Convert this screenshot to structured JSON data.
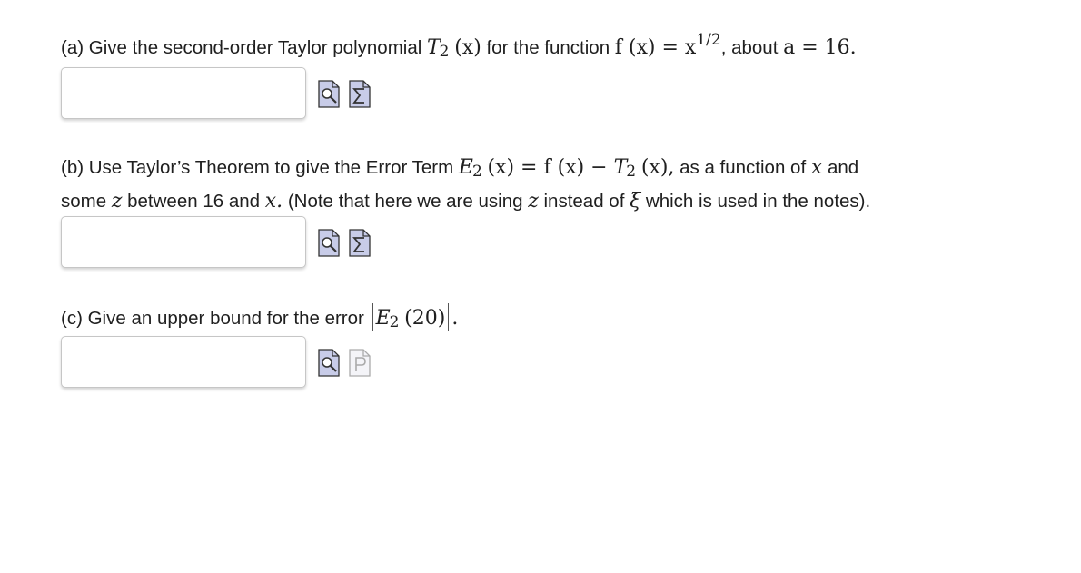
{
  "questions": [
    {
      "label": "(a) Give the second-order Taylor polynomial ",
      "t_sym": "T",
      "t_sub": "2",
      "t_arg": "(x)",
      "mid": " for the function ",
      "f_expr": "f (x) = x",
      "f_exp": "1/2",
      "about": ", about ",
      "a_expr": "a = 16",
      "end": ".",
      "input_value": "",
      "icons": [
        "preview-icon",
        "equation-editor-icon"
      ]
    },
    {
      "line1_start": "(b) Use Taylor’s Theorem to give the Error Term ",
      "e_sym": "E",
      "e_sub": "2",
      "e_rest": "(x) = f (x) − ",
      "t_sym": "T",
      "t_sub": "2",
      "t_arg": "(x),",
      "line1_end": " as a function of ",
      "x_var": "x",
      "and": " and",
      "line2_start": "some ",
      "z_var": "z",
      "line2_mid": " between 16 and ",
      "x_var2": "x.",
      "line2_note": " (Note that here we are using ",
      "z_var2": "z",
      "instead": " instead of ",
      "xi": "ξ",
      "line2_end": " which is used in the notes).",
      "input_value": "",
      "icons": [
        "preview-icon",
        "equation-editor-icon"
      ]
    },
    {
      "label": "(c) Give an upper bound for the error ",
      "e_sym": "E",
      "e_sub": "2",
      "e_arg": "(20)",
      "end": ".",
      "input_value": "",
      "icons": [
        "preview-icon",
        "paste-icon-disabled"
      ]
    }
  ]
}
